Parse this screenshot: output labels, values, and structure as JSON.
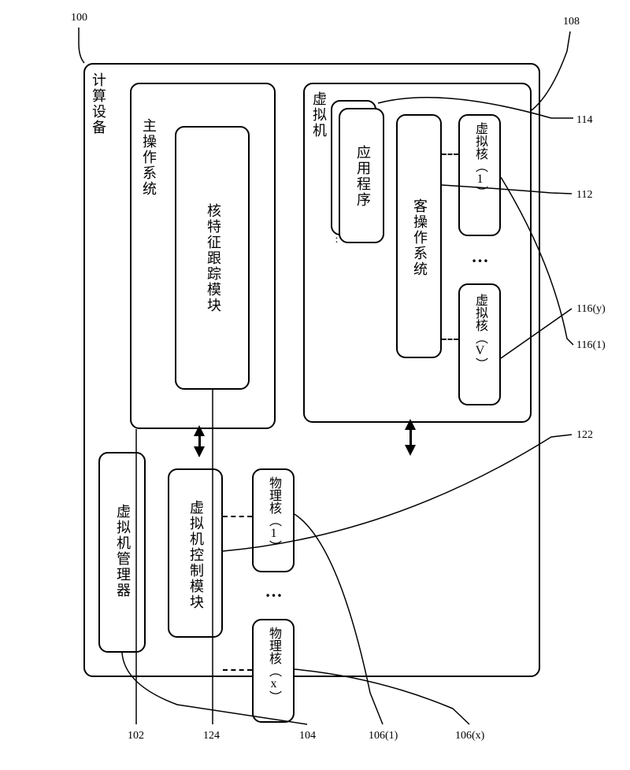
{
  "labels": {
    "computing_device": "计算设备",
    "host_os": "主操作系统",
    "core_tracking_module": "核特征跟踪模块",
    "virtual_machine": "虚拟机",
    "apps": "应用程序",
    "guest_os": "客操作系统",
    "vcore1": "虚拟核（1）",
    "vcorev": "虚拟核（V）",
    "vmm": "虚拟机管理器",
    "vm_control_module": "虚拟机控制模块",
    "pcore1": "物理核（1）",
    "pcorex": "物理核（x）",
    "dots_v": "…",
    "dots_p": "…"
  },
  "refs": {
    "r100": "100",
    "r102": "102",
    "r104": "104",
    "r106_1": "106(1)",
    "r106_x": "106(x)",
    "r108": "108",
    "r112": "112",
    "r114": "114",
    "r116_1": "116(1)",
    "r116_y": "116(y)",
    "r122": "122",
    "r124": "124"
  }
}
